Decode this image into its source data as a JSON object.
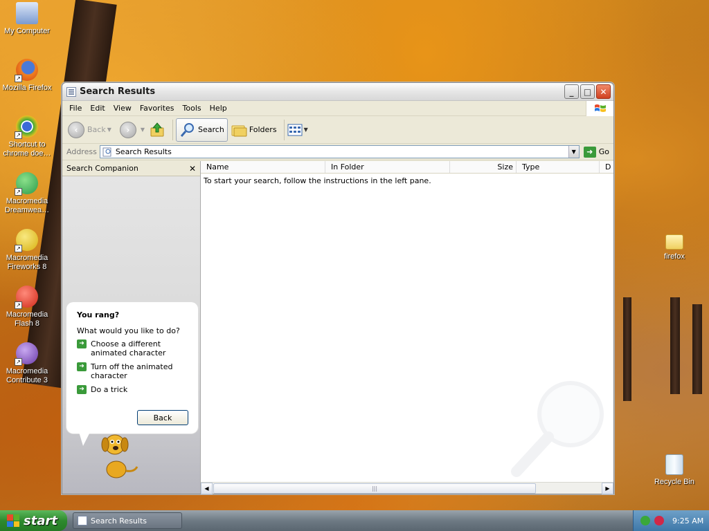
{
  "desktop": {
    "icons": [
      {
        "label": "My Computer",
        "icon": "computer-icon"
      },
      {
        "label": "Mozilla Firefox",
        "icon": "firefox-icon"
      },
      {
        "label": "Shortcut to chrome doe…",
        "icon": "chrome-shortcut-icon"
      },
      {
        "label": "Macromedia Dreamwea…",
        "icon": "dreamweaver-icon"
      },
      {
        "label": "Macromedia Fireworks 8",
        "icon": "fireworks-icon"
      },
      {
        "label": "Macromedia Flash 8",
        "icon": "flash-icon"
      },
      {
        "label": "Macromedia Contribute 3",
        "icon": "contribute-icon"
      },
      {
        "label": "firefox",
        "icon": "folder-icon"
      },
      {
        "label": "Recycle Bin",
        "icon": "recycle-bin-icon"
      }
    ]
  },
  "window": {
    "title": "Search Results",
    "menu": [
      "File",
      "Edit",
      "View",
      "Favorites",
      "Tools",
      "Help"
    ],
    "toolbar": {
      "back": "Back",
      "search": "Search",
      "folders": "Folders"
    },
    "address": {
      "label": "Address",
      "value": "Search Results",
      "go": "Go"
    },
    "left_pane": {
      "title": "Search Companion",
      "balloon": {
        "heading": "You rang?",
        "question": "What would you like to do?",
        "options": [
          "Choose a different animated character",
          "Turn off the animated character",
          "Do a trick"
        ],
        "back_button": "Back"
      }
    },
    "results": {
      "columns": [
        "Name",
        "In Folder",
        "Size",
        "Type",
        "D"
      ],
      "message": "To start your search, follow the instructions in the left pane."
    }
  },
  "taskbar": {
    "start": "start",
    "task": "Search Results",
    "clock": "9:25 AM"
  },
  "colors": {
    "start_green": "#2e8a2e",
    "tray_blue": "#3e78a8",
    "window_bg": "#ece9d8"
  }
}
